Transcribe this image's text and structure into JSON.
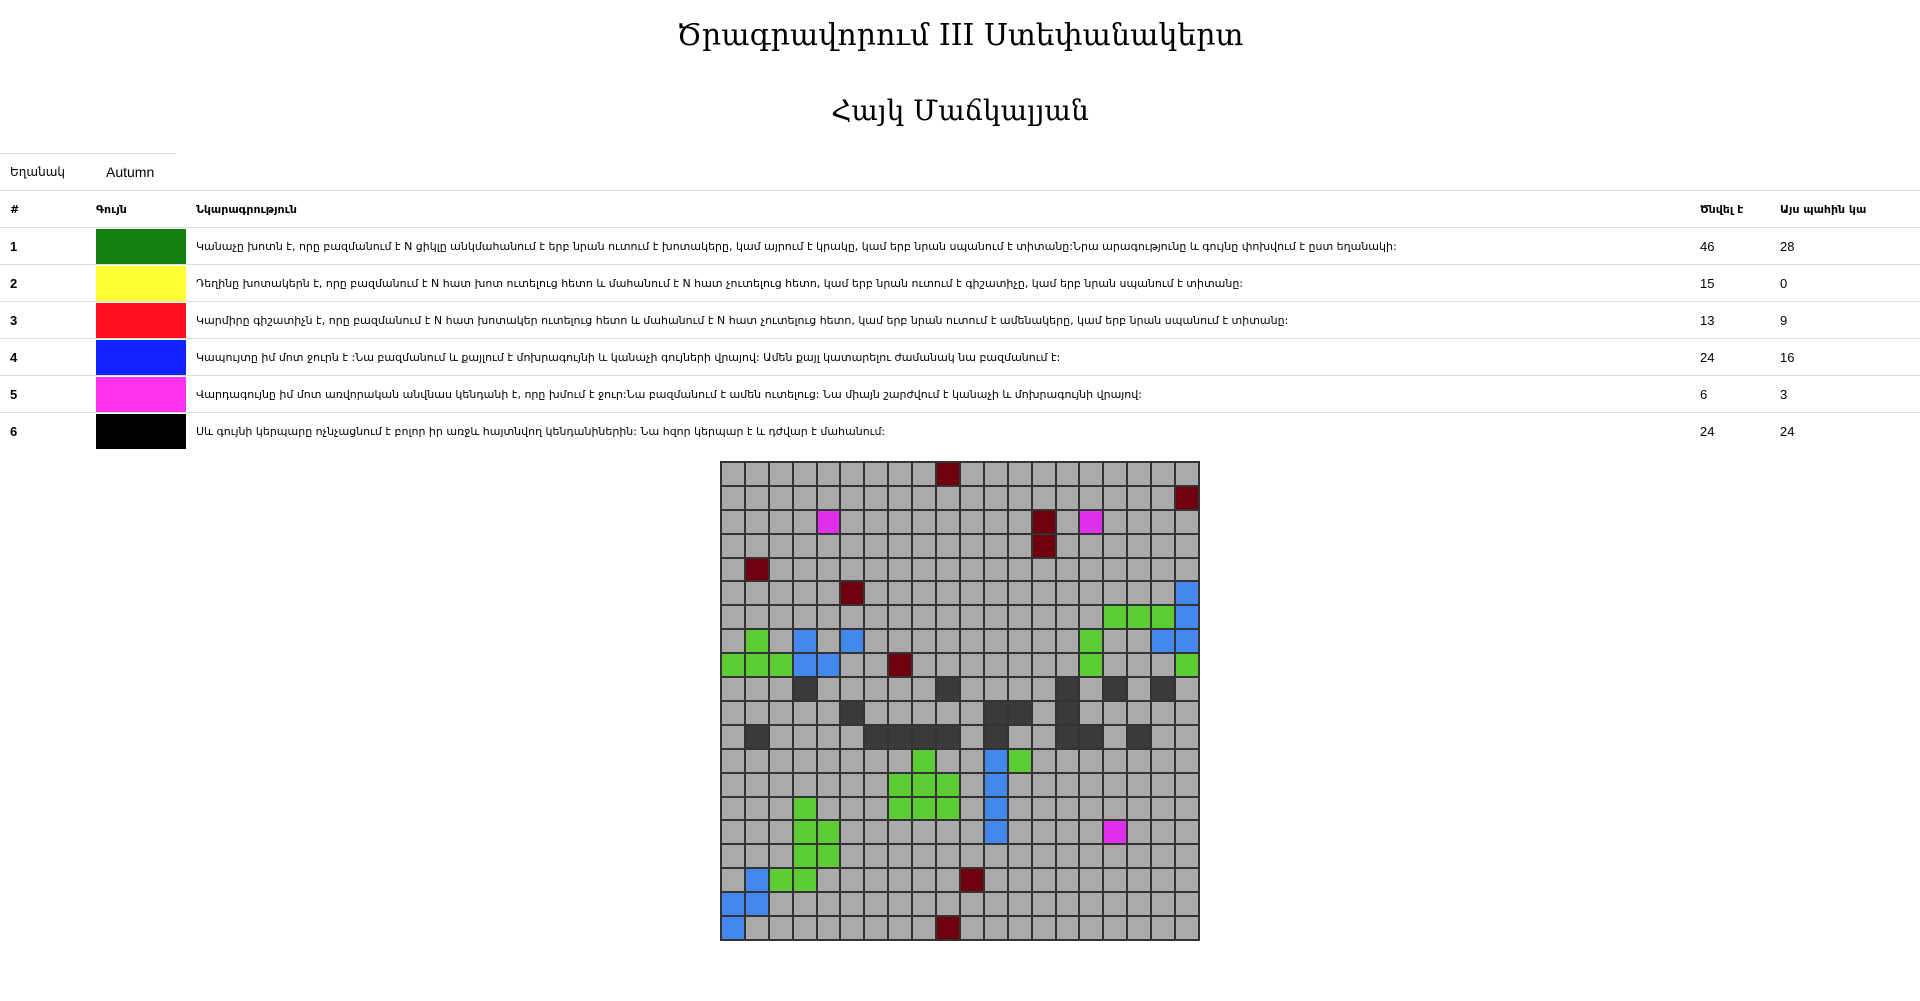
{
  "title": "Ծրագրավորում III Ստեփանակերտ",
  "subtitle": "Հայկ Մաճկալյան",
  "season": {
    "label": "Եղանակ",
    "value": "Autumn"
  },
  "table": {
    "headers": {
      "num": "#",
      "color": "Գույն",
      "desc": "Նկարագրություն",
      "alive": "Ծնվել է",
      "now": "Այս պահին կա"
    },
    "rows": [
      {
        "num": "1",
        "color": "#118011",
        "desc": "Կանաչը խոտն է, որը բազմանում է N ցիկլը անկմահանում է երբ նրան ուտում է խոտակերը, կամ այրում է կրակը, կամ երբ նրան սպանում է տիտանը:Նրա արագությունը և գույնը փոխվում է ըստ եղանակի:",
        "alive": "46",
        "now": "28"
      },
      {
        "num": "2",
        "color": "#ffff33",
        "desc": "Դեղինը խոտակերն է, որը բազմանում է N հատ խոտ ուտելուց հետո և մահանում է N հատ չուտելուց հետո, կամ երբ նրան ուտում է գիշատիչը, կամ երբ նրան սպանում է տիտանը:",
        "alive": "15",
        "now": "0"
      },
      {
        "num": "3",
        "color": "#ff1122",
        "desc": "Կարմիրը գիշատիչն է, որը բազմանում է N հատ խոտակեր ուտելուց հետո և մահանում է N հատ չուտելուց հետո, կամ երբ նրան ուտում է ամենակերը, կամ երբ նրան սպանում է տիտանը:",
        "alive": "13",
        "now": "9"
      },
      {
        "num": "4",
        "color": "#1122ff",
        "desc": "Կապույտը իմ մոտ ջուրն է :Նա բազմանում և քայլում է մոխրագույնի և կանաչի գույների վրայով: Ամեն քայլ կատարելու ժամանակ նա բազմանում է:",
        "alive": "24",
        "now": "16"
      },
      {
        "num": "5",
        "color": "#ff33ee",
        "desc": "Վարդագույնը իմ մոտ առվորական անվնաս կենդանի է, որը խմում է ջուր:Նա բազմանում է ամեն ուտելուց: Նա միայն շարժվում է կանաչի և մոխրագույնի վրայով:",
        "alive": "6",
        "now": "3"
      },
      {
        "num": "6",
        "color": "#000000",
        "desc": "Սև գույնի կերպարը ոչնչացնում է բոլոր իր առջև հայտնվող կենդանիներին: Նա հզոր կերպար է և դժվար է մահանում:",
        "alive": "24",
        "now": "24"
      }
    ]
  },
  "matrix": {
    "palette": {
      "0": "#aaaaaa",
      "1": "#5bcc33",
      "2": "#ffff33",
      "3": "#700010",
      "4": "#4488ee",
      "5": "#e030ee",
      "6": "#3a3a3a"
    },
    "rows": [
      [
        0,
        0,
        0,
        0,
        0,
        0,
        0,
        0,
        0,
        3,
        0,
        0,
        0,
        0,
        0,
        0,
        0,
        0,
        0,
        0
      ],
      [
        0,
        0,
        0,
        0,
        0,
        0,
        0,
        0,
        0,
        0,
        0,
        0,
        0,
        0,
        0,
        0,
        0,
        0,
        0,
        3
      ],
      [
        0,
        0,
        0,
        0,
        5,
        0,
        0,
        0,
        0,
        0,
        0,
        0,
        0,
        3,
        0,
        5,
        0,
        0,
        0,
        0
      ],
      [
        0,
        0,
        0,
        0,
        0,
        0,
        0,
        0,
        0,
        0,
        0,
        0,
        0,
        3,
        0,
        0,
        0,
        0,
        0,
        0
      ],
      [
        0,
        3,
        0,
        0,
        0,
        0,
        0,
        0,
        0,
        0,
        0,
        0,
        0,
        0,
        0,
        0,
        0,
        0,
        0,
        0
      ],
      [
        0,
        0,
        0,
        0,
        0,
        3,
        0,
        0,
        0,
        0,
        0,
        0,
        0,
        0,
        0,
        0,
        0,
        0,
        0,
        4
      ],
      [
        0,
        0,
        0,
        0,
        0,
        0,
        0,
        0,
        0,
        0,
        0,
        0,
        0,
        0,
        0,
        0,
        1,
        1,
        1,
        4
      ],
      [
        0,
        1,
        0,
        4,
        0,
        4,
        0,
        0,
        0,
        0,
        0,
        0,
        0,
        0,
        0,
        1,
        0,
        0,
        4,
        4
      ],
      [
        1,
        1,
        1,
        4,
        4,
        0,
        0,
        3,
        0,
        0,
        0,
        0,
        0,
        0,
        0,
        1,
        0,
        0,
        0,
        1
      ],
      [
        0,
        0,
        0,
        6,
        0,
        0,
        0,
        0,
        0,
        6,
        0,
        0,
        0,
        0,
        6,
        0,
        6,
        0,
        6,
        0
      ],
      [
        0,
        0,
        0,
        0,
        0,
        6,
        0,
        0,
        0,
        0,
        0,
        6,
        6,
        0,
        6,
        0,
        0,
        0,
        0,
        0
      ],
      [
        0,
        6,
        0,
        0,
        0,
        0,
        6,
        6,
        6,
        6,
        0,
        6,
        0,
        0,
        6,
        6,
        0,
        6,
        0,
        0
      ],
      [
        0,
        0,
        0,
        0,
        0,
        0,
        0,
        0,
        1,
        0,
        0,
        4,
        1,
        0,
        0,
        0,
        0,
        0,
        0,
        0
      ],
      [
        0,
        0,
        0,
        0,
        0,
        0,
        0,
        1,
        1,
        1,
        0,
        4,
        0,
        0,
        0,
        0,
        0,
        0,
        0,
        0
      ],
      [
        0,
        0,
        0,
        1,
        0,
        0,
        0,
        1,
        1,
        1,
        0,
        4,
        0,
        0,
        0,
        0,
        0,
        0,
        0,
        0
      ],
      [
        0,
        0,
        0,
        1,
        1,
        0,
        0,
        0,
        0,
        0,
        0,
        4,
        0,
        0,
        0,
        0,
        5,
        0,
        0,
        0
      ],
      [
        0,
        0,
        0,
        1,
        1,
        0,
        0,
        0,
        0,
        0,
        0,
        0,
        0,
        0,
        0,
        0,
        0,
        0,
        0,
        0
      ],
      [
        0,
        4,
        1,
        1,
        0,
        0,
        0,
        0,
        0,
        0,
        3,
        0,
        0,
        0,
        0,
        0,
        0,
        0,
        0,
        0
      ],
      [
        4,
        4,
        0,
        0,
        0,
        0,
        0,
        0,
        0,
        0,
        0,
        0,
        0,
        0,
        0,
        0,
        0,
        0,
        0,
        0
      ],
      [
        4,
        0,
        0,
        0,
        0,
        0,
        0,
        0,
        0,
        3,
        0,
        0,
        0,
        0,
        0,
        0,
        0,
        0,
        0,
        0
      ]
    ]
  }
}
